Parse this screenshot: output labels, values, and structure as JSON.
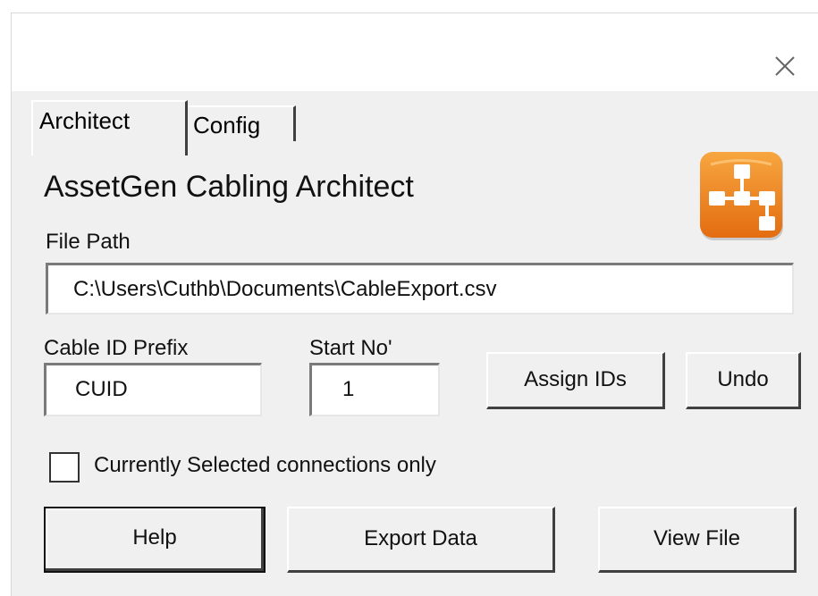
{
  "window": {
    "close_icon": "close-icon"
  },
  "tabs": {
    "architect": "Architect",
    "config": "Config"
  },
  "header": {
    "title": "AssetGen Cabling Architect",
    "logo_icon": "org-chart-icon",
    "logo_color": "#f08a1c"
  },
  "file_path": {
    "label": "File Path",
    "value": "C:\\Users\\Cuthb\\Documents\\CableExport.csv"
  },
  "cable_id_prefix": {
    "label": "Cable ID Prefix",
    "value": "CUID"
  },
  "start_no": {
    "label": "Start No'",
    "value": "1"
  },
  "buttons": {
    "assign_ids": "Assign IDs",
    "undo": "Undo",
    "help": "Help",
    "export_data": "Export Data",
    "view_file": "View File"
  },
  "selection_option": {
    "label": "Currently Selected connections only",
    "checked": false
  }
}
